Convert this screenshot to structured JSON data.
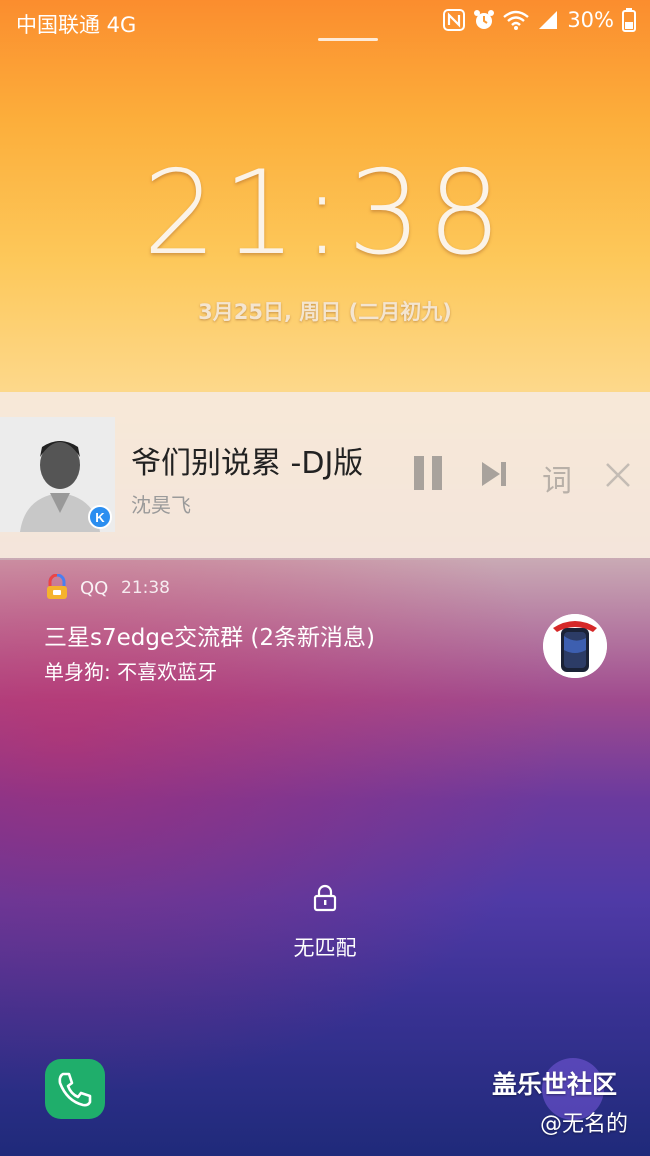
{
  "status_bar": {
    "carrier": "中国联通 4G",
    "battery": "30%",
    "icons": [
      "nfc-icon",
      "alarm-icon",
      "wifi-icon",
      "signal-icon",
      "battery-icon"
    ]
  },
  "lockscreen": {
    "time": "21:38",
    "date": "3月25日, 周日 (二月初九)"
  },
  "music": {
    "title": "爷们别说累 -DJ版",
    "artist": "沈昊飞",
    "lyrics_label": "词",
    "app_badge": "K"
  },
  "notification": {
    "app": "QQ",
    "time": "21:38",
    "title": "三星s7edge交流群 (2条新消息)",
    "text": "单身狗: 不喜欢蓝牙"
  },
  "unlock": {
    "label": "无匹配"
  },
  "watermark": {
    "logo": "盖乐世社区",
    "user": "@无名的"
  },
  "colors": {
    "music_card": "#f6eade",
    "phone": "#1fae6b"
  }
}
